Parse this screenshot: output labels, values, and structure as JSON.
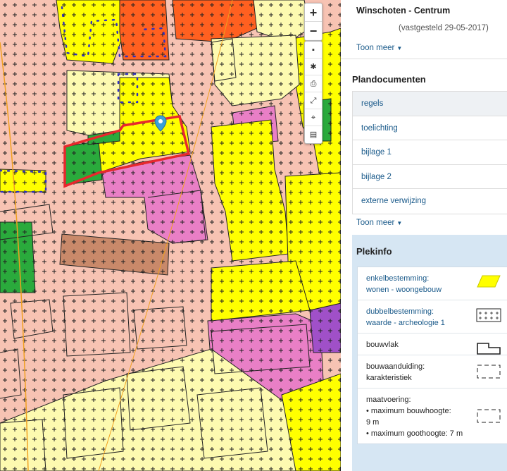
{
  "map": {
    "zoom_in_label": "+",
    "zoom_out_label": "−",
    "tools": [
      "layers-icon",
      "settings-icon",
      "print-icon",
      "fullscreen-icon",
      "locate-icon",
      "legend-icon"
    ],
    "colors": {
      "background": "#f7c3b3",
      "wonen": "#fdfab0",
      "bedrijf": "#ffff00",
      "groen": "#2aaa3c",
      "centrum": "#ff6020",
      "maatschappelijk": "#e97fc6",
      "horeca": "#c9896a",
      "cultuur": "#a050c8",
      "selection": "#e8282d",
      "marker": "#3aa0d8"
    }
  },
  "panel": {
    "plan_name": "Winschoten - Centrum",
    "plan_date": "(vastgesteld 29-05-2017)",
    "toon_meer_1": "Toon meer",
    "plandocumenten_title": "Plandocumenten",
    "documents": [
      {
        "label": "regels",
        "active": true
      },
      {
        "label": "toelichting",
        "active": false
      },
      {
        "label": "bijlage 1",
        "active": false
      },
      {
        "label": "bijlage 2",
        "active": false
      },
      {
        "label": "externe verwijzing",
        "active": false
      }
    ],
    "toon_meer_2": "Toon meer"
  },
  "plekinfo": {
    "title": "Plekinfo",
    "items": [
      {
        "lines": [
          "enkelbestemming:",
          "wonen - woongebouw"
        ],
        "link": true,
        "symbol": "yellow-parallelogram-icon"
      },
      {
        "lines": [
          "dubbelbestemming:",
          "waarde - archeologie 1"
        ],
        "link": true,
        "symbol": "crosshatch-icon"
      },
      {
        "lines": [
          "bouwvlak"
        ],
        "link": false,
        "symbol": "bouwvlak-outline-icon"
      },
      {
        "lines": [
          "bouwaanduiding:",
          "karakteristiek"
        ],
        "link": false,
        "symbol": "dashed-box-icon"
      },
      {
        "lines": [
          "maatvoering:",
          "• maximum bouwhoogte:",
          "9 m",
          "• maximum goothoogte: 7 m"
        ],
        "link": false,
        "symbol": "dashed-box-icon"
      }
    ]
  }
}
